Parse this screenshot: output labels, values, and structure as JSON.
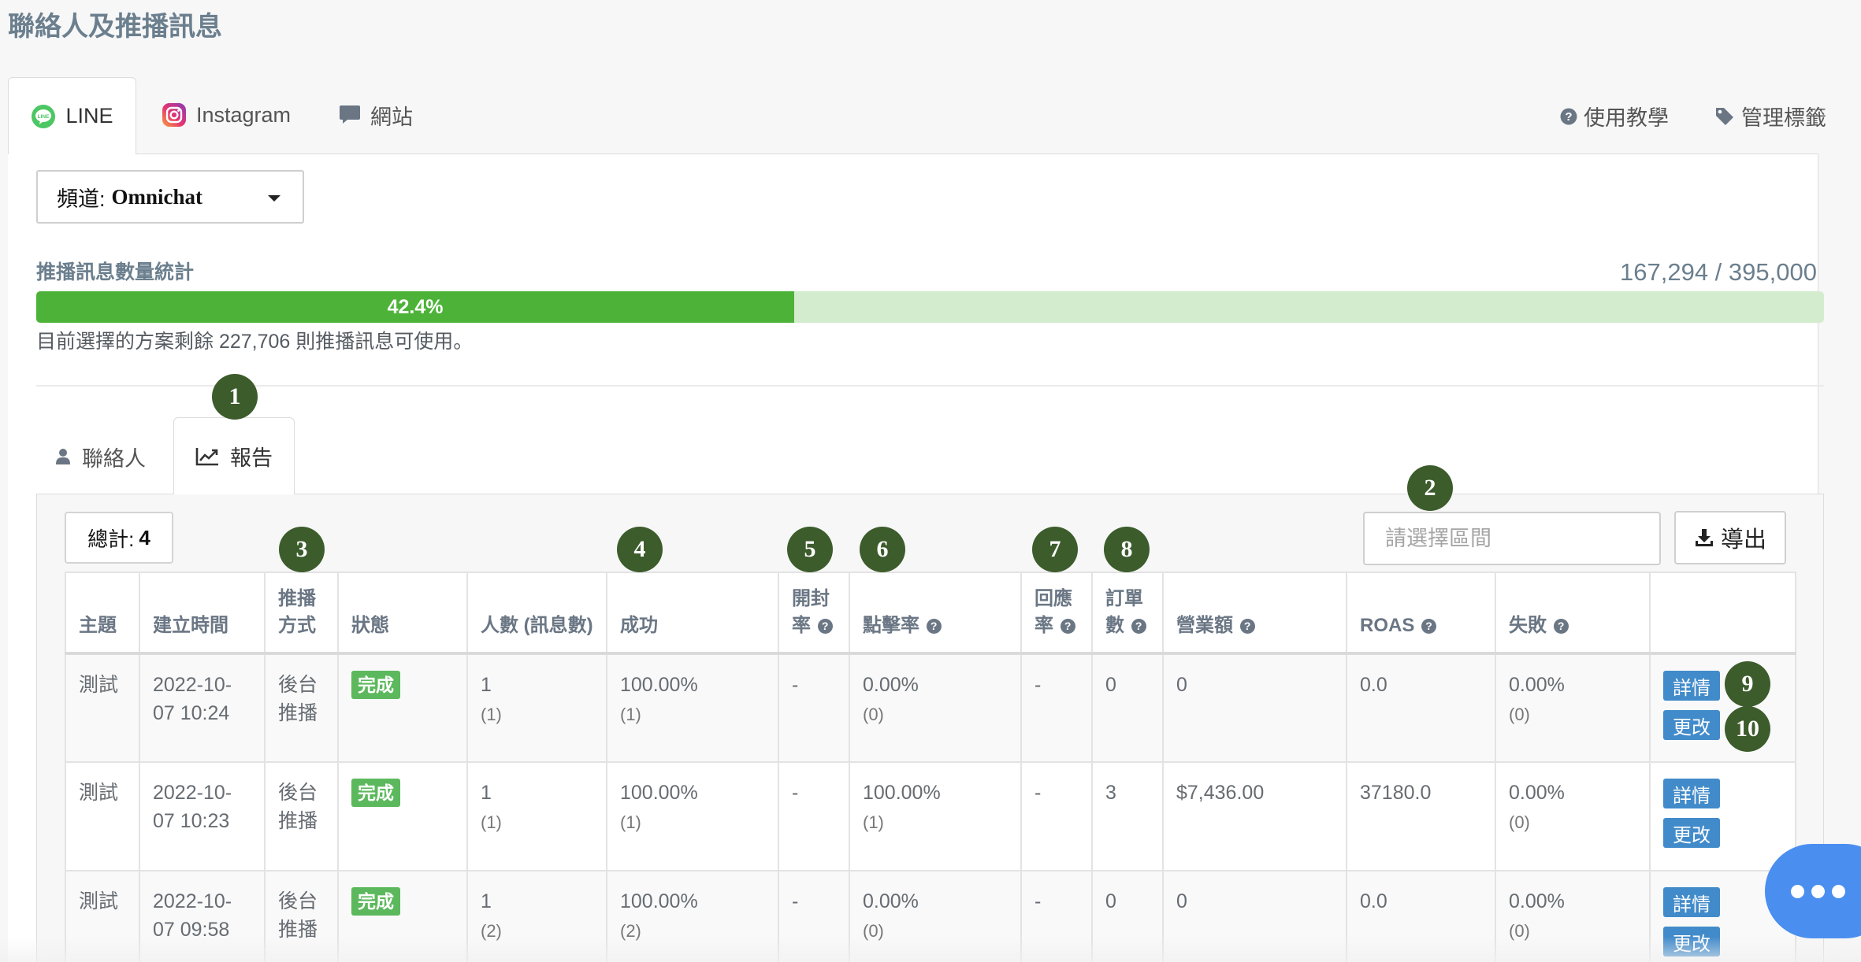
{
  "page": {
    "title": "聯絡人及推播訊息"
  },
  "channel_tabs": [
    {
      "label": "LINE",
      "icon": "line-icon",
      "active": true
    },
    {
      "label": "Instagram",
      "icon": "instagram-icon",
      "active": false
    },
    {
      "label": "網站",
      "icon": "comment-icon",
      "active": false
    }
  ],
  "header_links": {
    "help": "使用教學",
    "tags": "管理標籤"
  },
  "channel_select": {
    "label": "頻道:",
    "value": "Omnichat"
  },
  "quota": {
    "title": "推播訊息數量統計",
    "used": "167,294",
    "total": "395,000",
    "count_text": "167,294 / 395,000",
    "percent": 42.4,
    "percent_text": "42.4%",
    "remaining_text": "目前選擇的方案剩餘 227,706 則推播訊息可使用。"
  },
  "sub_tabs": [
    {
      "label": "聯絡人",
      "icon": "user-icon",
      "active": false
    },
    {
      "label": "報告",
      "icon": "line-chart-icon",
      "active": true
    }
  ],
  "toolbar": {
    "total_label": "總計:",
    "total_value": "4",
    "range_placeholder": "請選擇區間",
    "export_label": "導出"
  },
  "table": {
    "columns": [
      {
        "label": "主題",
        "help": false
      },
      {
        "label": "建立時間",
        "help": false
      },
      {
        "label": "推播方式",
        "help": false
      },
      {
        "label": "狀態",
        "help": false
      },
      {
        "label": "人數 (訊息數)",
        "help": false
      },
      {
        "label": "成功",
        "help": false
      },
      {
        "label": "開封率",
        "help": true
      },
      {
        "label": "點擊率",
        "help": true
      },
      {
        "label": "回應率",
        "help": true
      },
      {
        "label": "訂單數",
        "help": true
      },
      {
        "label": "營業額",
        "help": true
      },
      {
        "label": "ROAS",
        "help": true
      },
      {
        "label": "失敗",
        "help": true
      },
      {
        "label": "",
        "help": false
      }
    ],
    "rows": [
      {
        "subject": "測試",
        "created": "2022-10-07 10:24",
        "method": "後台推播",
        "status": "完成",
        "people": "1",
        "people_sub": "(1)",
        "success": "100.00%",
        "success_sub": "(1)",
        "open_rate": "-",
        "click_rate": "0.00%",
        "click_sub": "(0)",
        "reply_rate": "-",
        "orders": "0",
        "revenue": "0",
        "roas": "0.0",
        "fail": "0.00%",
        "fail_sub": "(0)",
        "detail_label": "詳情",
        "edit_label": "更改"
      },
      {
        "subject": "測試",
        "created": "2022-10-07 10:23",
        "method": "後台推播",
        "status": "完成",
        "people": "1",
        "people_sub": "(1)",
        "success": "100.00%",
        "success_sub": "(1)",
        "open_rate": "-",
        "click_rate": "100.00%",
        "click_sub": "(1)",
        "reply_rate": "-",
        "orders": "3",
        "revenue": "$7,436.00",
        "roas": "37180.0",
        "fail": "0.00%",
        "fail_sub": "(0)",
        "detail_label": "詳情",
        "edit_label": "更改"
      },
      {
        "subject": "測試",
        "created": "2022-10-07 09:58",
        "method": "後台推播",
        "status": "完成",
        "people": "1",
        "people_sub": "(2)",
        "success": "100.00%",
        "success_sub": "(2)",
        "open_rate": "-",
        "click_rate": "0.00%",
        "click_sub": "(0)",
        "reply_rate": "-",
        "orders": "0",
        "revenue": "0",
        "roas": "0.0",
        "fail": "0.00%",
        "fail_sub": "(0)",
        "detail_label": "詳情",
        "edit_label": "更改"
      }
    ]
  },
  "markers": [
    "1",
    "2",
    "3",
    "4",
    "5",
    "6",
    "7",
    "8",
    "9",
    "10"
  ],
  "colors": {
    "progress_fill": "#4db338",
    "progress_track": "#d3ecce",
    "marker": "#3d5c2c",
    "action_button": "#428bca",
    "status_badge": "#5cb85c",
    "chat_fab": "#4a8ef0"
  }
}
